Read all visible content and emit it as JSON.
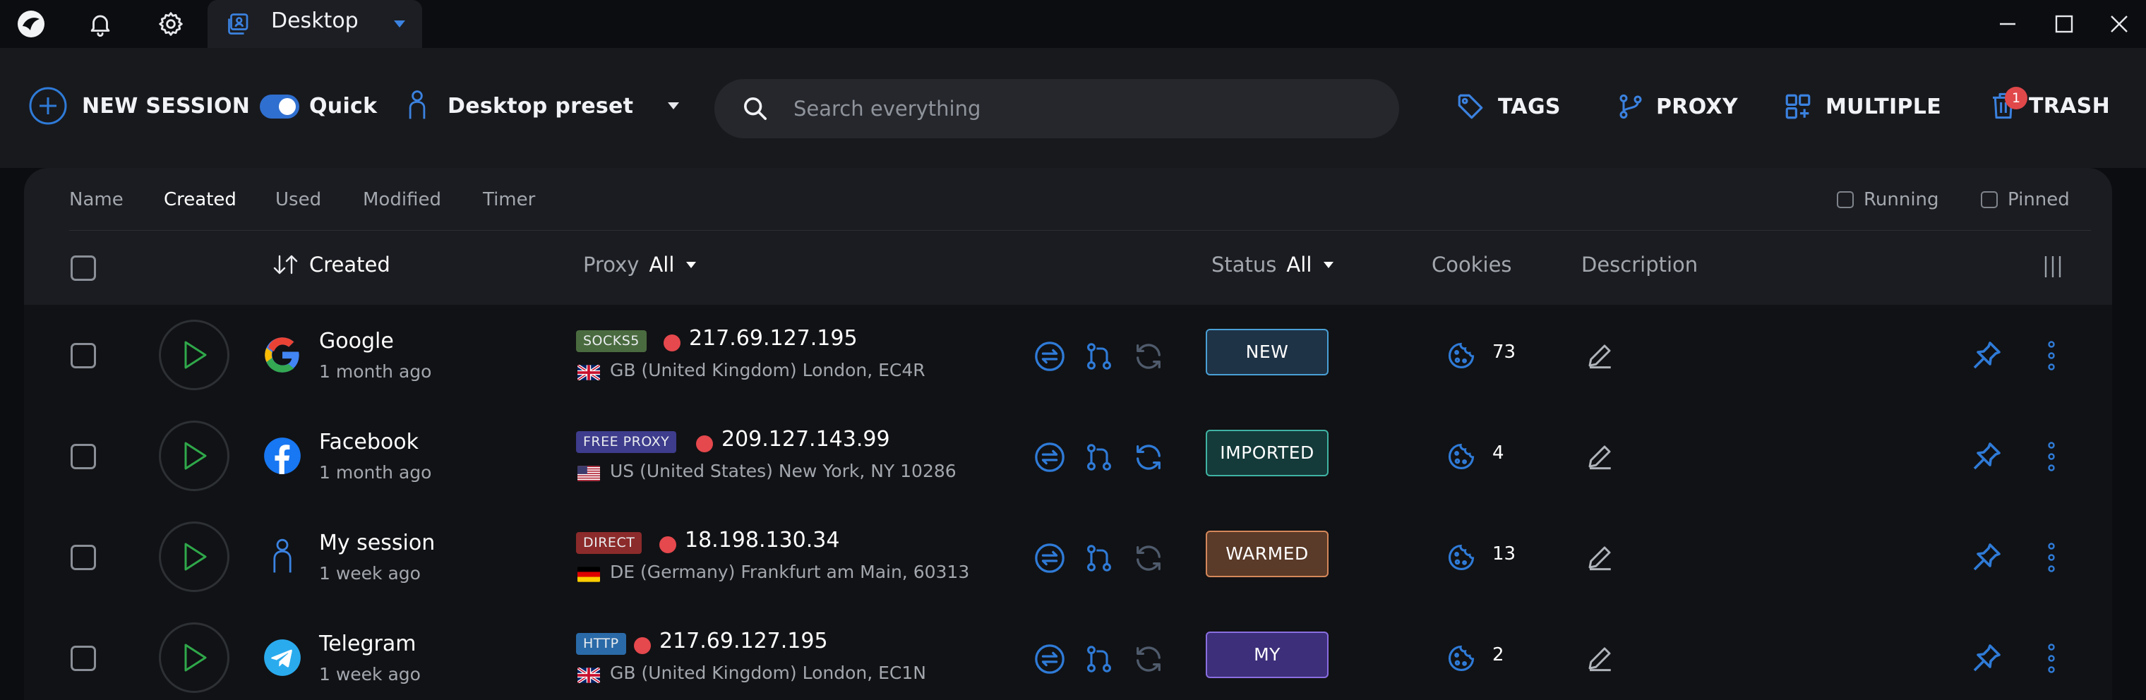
{
  "titlebar": {
    "tab_label": "Desktop"
  },
  "toolbar": {
    "new_session": "NEW SESSION",
    "quick": "Quick",
    "preset": "Desktop preset",
    "search_placeholder": "Search everything",
    "tags": "TAGS",
    "proxy": "PROXY",
    "multiple": "MULTIPLE",
    "trash": "TRASH",
    "trash_count": "1"
  },
  "sort_tabs": [
    "Name",
    "Created",
    "Used",
    "Modified",
    "Timer"
  ],
  "filters": {
    "running": "Running",
    "pinned": "Pinned"
  },
  "columns": {
    "created": "Created",
    "proxy": "Proxy",
    "proxy_filter": "All",
    "status": "Status",
    "status_filter": "All",
    "cookies": "Cookies",
    "description": "Description"
  },
  "colors": {
    "accent": "#2f7bd8",
    "play_green": "#2fa84a",
    "ip_dot": "#e5484d"
  },
  "sessions": [
    {
      "name": "Google",
      "created": "1 month ago",
      "icon": "google-icon",
      "proxy_type": "SOCKS5",
      "proxy_color": "#4a6b3f",
      "ip": "217.69.127.195",
      "flag": "gb",
      "location": "GB (United Kingdom) London, EC4R",
      "status": "NEW",
      "status_bg": "#1f3346",
      "status_border": "#4aa0d6",
      "cookies": "73"
    },
    {
      "name": "Facebook",
      "created": "1 month ago",
      "icon": "facebook-icon",
      "proxy_type": "FREE PROXY",
      "proxy_color": "#3e3c8c",
      "ip": "209.127.143.99",
      "flag": "us",
      "location": "US (United States) New York, NY 10286",
      "status": "IMPORTED",
      "status_bg": "#153a3a",
      "status_border": "#3fb4a4",
      "cookies": "4"
    },
    {
      "name": "My session",
      "created": "1 week ago",
      "icon": "person-icon",
      "proxy_type": "DIRECT",
      "proxy_color": "#8c2b2b",
      "ip": "18.198.130.34",
      "flag": "de",
      "location": "DE (Germany) Frankfurt am Main, 60313",
      "status": "WARMED",
      "status_bg": "#5a3a28",
      "status_border": "#d4875a",
      "cookies": "13"
    },
    {
      "name": "Telegram",
      "created": "1 week ago",
      "icon": "telegram-icon",
      "proxy_type": "HTTP",
      "proxy_color": "#2a6aa8",
      "ip": "217.69.127.195",
      "flag": "gb",
      "location": "GB (United Kingdom) London, EC1N",
      "status": "MY",
      "status_bg": "#3d2f7a",
      "status_border": "#8a6ee0",
      "cookies": "2"
    }
  ]
}
